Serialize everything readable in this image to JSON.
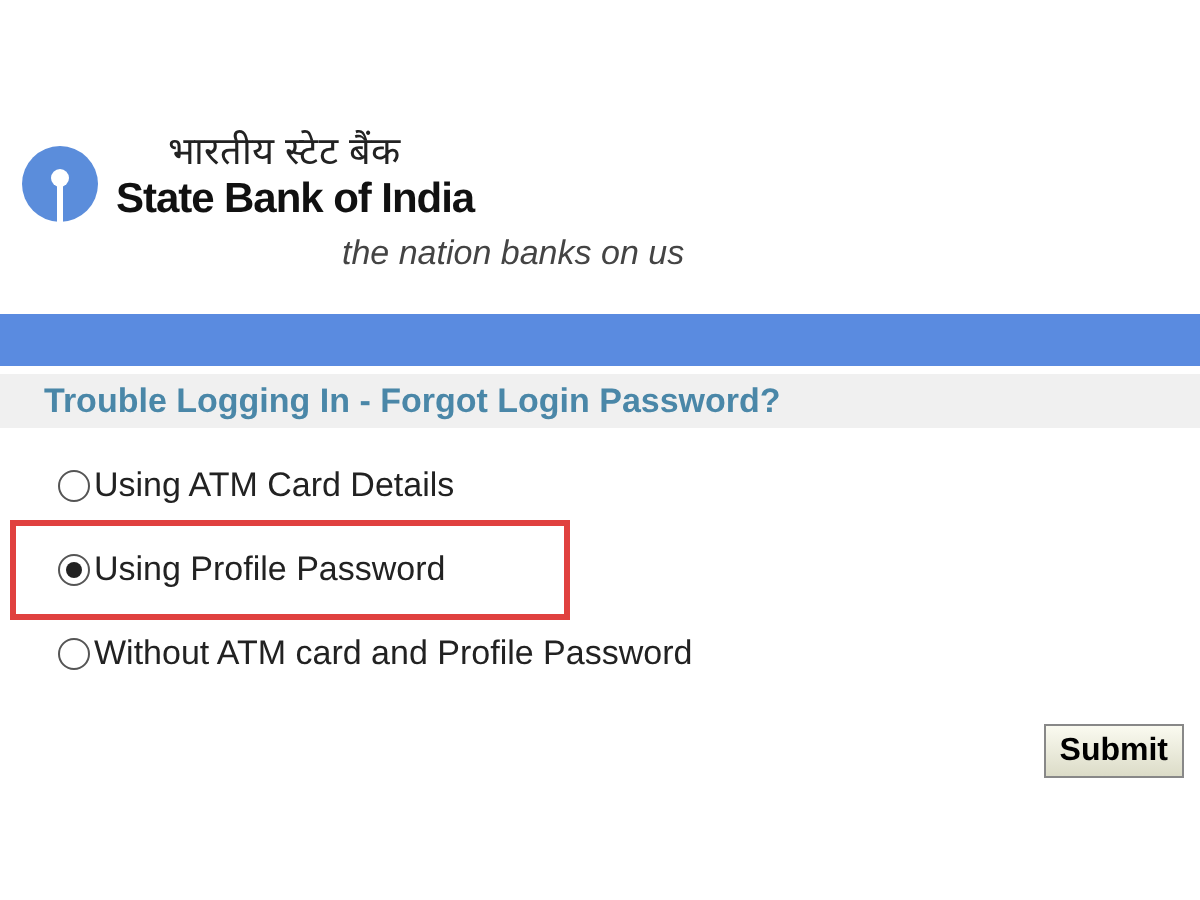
{
  "logo": {
    "hindi_name": "भारतीय स्टेट बैंक",
    "name": "State Bank of India",
    "tagline": "the nation banks on us"
  },
  "heading": "Trouble Logging In - Forgot Login Password?",
  "options": [
    {
      "label": "Using ATM Card Details",
      "selected": false,
      "highlighted": false
    },
    {
      "label": "Using Profile Password",
      "selected": true,
      "highlighted": true
    },
    {
      "label": "Without ATM card and Profile Password",
      "selected": false,
      "highlighted": false
    }
  ],
  "submit": "Submit"
}
